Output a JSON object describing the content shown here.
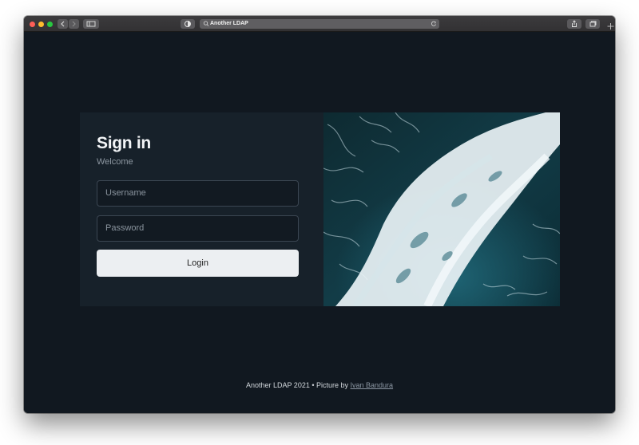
{
  "browser": {
    "url_text": "Another LDAP"
  },
  "login": {
    "title": "Sign in",
    "subtitle": "Welcome",
    "username_placeholder": "Username",
    "password_placeholder": "Password",
    "button_label": "Login"
  },
  "footer": {
    "text": "Another LDAP 2021 • Picture by",
    "credit_link": "Ivan Bandura"
  },
  "colors": {
    "background": "#111820",
    "card": "#17212a",
    "button": "#eceff2"
  }
}
